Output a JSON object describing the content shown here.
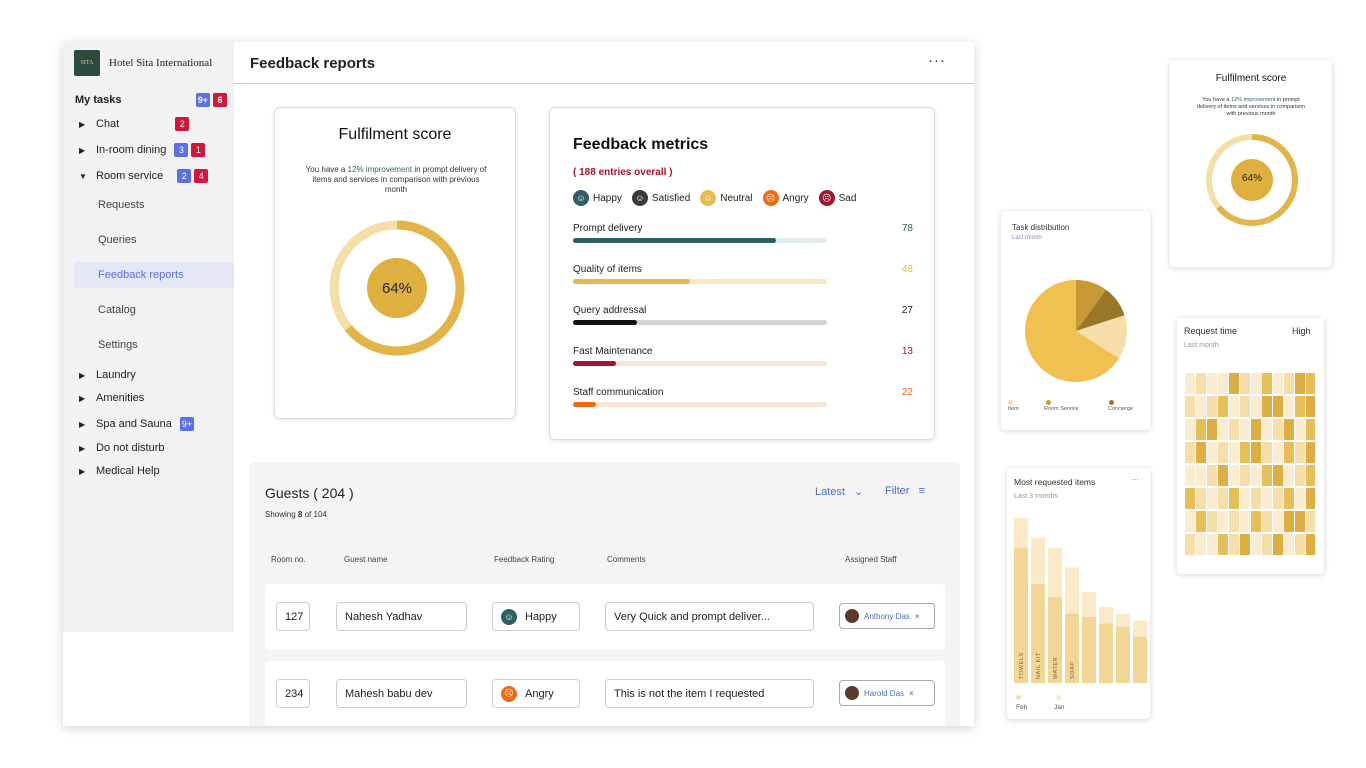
{
  "brand": {
    "name": "Hotel Sita International",
    "logo_text": "SITA"
  },
  "sidebar": {
    "heading": "My tasks",
    "heading_badges": [
      "9+",
      "6"
    ],
    "items": [
      {
        "label": "Chat",
        "badges": [
          "2"
        ]
      },
      {
        "label": "In-room dining",
        "badges": [
          "3",
          "1"
        ]
      },
      {
        "label": "Room service",
        "badges": [
          "2",
          "4"
        ]
      },
      {
        "label": "Laundry"
      },
      {
        "label": "Amenities"
      },
      {
        "label": "Spa and Sauna",
        "badges": [
          "9+"
        ]
      },
      {
        "label": "Do not disturb"
      },
      {
        "label": "Medical Help"
      }
    ],
    "subitems": [
      "Requests",
      "Queries",
      "Feedback reports",
      "Catalog",
      "Settings"
    ]
  },
  "header": {
    "title": "Feedback reports",
    "more": "···"
  },
  "fulfilment": {
    "title": "Fulfilment score",
    "desc_pre": "You have a ",
    "desc_hl": "12% improvement",
    "desc_post": " in prompt delivery of items and services in comparison with previous month",
    "score": "64%",
    "score_value": 0.64
  },
  "metrics": {
    "title": "Feedback metrics",
    "entries": "( 188  entries overall )",
    "legend": [
      {
        "label": "Happy",
        "color": "#2f5f63"
      },
      {
        "label": "Satisfied",
        "color": "#3a3a3a"
      },
      {
        "label": "Neutral",
        "color": "#e7b94f"
      },
      {
        "label": "Angry",
        "color": "#ec6a12"
      },
      {
        "label": "Sad",
        "color": "#a0152f"
      }
    ],
    "rows": [
      {
        "label": "Prompt  delivery",
        "value": "78",
        "fraction": 0.8,
        "color": "#2f5f63",
        "track": "#e1eeef",
        "value_color": "#2f5f63"
      },
      {
        "label": "Quality of items",
        "value": "48",
        "fraction": 0.46,
        "color": "#e7b94f",
        "track": "#f8e6bf",
        "value_color": "#e7b94f"
      },
      {
        "label": "Query addressal",
        "value": "27",
        "fraction": 0.25,
        "color": "#111111",
        "track": "#d4d4d4",
        "value_color": "#222222"
      },
      {
        "label": "Fast Maintenance",
        "value": "13",
        "fraction": 0.17,
        "color": "#a0152f",
        "track": "#fde2d6",
        "value_color": "#a0152f"
      },
      {
        "label": "Staff communication",
        "value": "22",
        "fraction": 0.09,
        "color": "#ec6a12",
        "track": "#fde2d6",
        "value_color": "#ec6a12"
      }
    ]
  },
  "guests": {
    "title": "Guests ( 204 )",
    "showing_pre": "Showing ",
    "showing_bold": "8",
    "showing_post": " of 104",
    "sort_label": "Latest",
    "filter_label": "Filter",
    "columns": [
      "Room no.",
      "Guest name",
      "Feedback Rating",
      "Comments",
      "Assigned Staff"
    ],
    "rows": [
      {
        "room": "127",
        "name": "Nahesh Yadhav",
        "rating": "Happy",
        "rating_color": "#2f5f63",
        "comment": "Very Quick and prompt deliver...",
        "staff": "Anthony Das"
      },
      {
        "room": "234",
        "name": "Mahesh babu dev",
        "rating": "Angry",
        "rating_color": "#ec6a12",
        "comment": "This is not the item I requested",
        "staff": "Harold Das"
      }
    ]
  },
  "mini_fulfilment": {
    "title": "Fulfilment score",
    "desc_pre": "You have a ",
    "desc_hl": "12% improvement",
    "desc_post": " in prompt delivery of items and services in comparison with previous month",
    "score": "64%"
  },
  "task_distribution": {
    "title": "Task distribution",
    "subtitle": "Last month",
    "chart_data": {
      "type": "pie",
      "series": [
        {
          "name": "Item",
          "value": 0.66,
          "color": "#f0c050"
        },
        {
          "name": "Room Service",
          "value": 0.14,
          "color": "#f5deaa"
        },
        {
          "name": "Concierge",
          "value": 0.1,
          "color": "#9a7628"
        },
        {
          "name": "",
          "value": 0.1,
          "color": "#c89a35"
        }
      ]
    },
    "legend": [
      "Item",
      "Room Service",
      "Concierge"
    ]
  },
  "request_time": {
    "title": "Request time",
    "level": "High",
    "subtitle": "Last month"
  },
  "most_requested": {
    "title": "Most requested items",
    "subtitle": "Last 3 months",
    "more": "···",
    "chart_data": {
      "type": "bar",
      "categories": [
        "TOWELS",
        "NAIL KIT",
        "WATER",
        "SOAP",
        "",
        "",
        "",
        ""
      ],
      "series": [
        {
          "name": "Feb",
          "values": [
            0.82,
            0.6,
            0.52,
            0.42,
            0.4,
            0.36,
            0.34,
            0.28
          ]
        },
        {
          "name": "Jan",
          "values": [
            1.0,
            0.88,
            0.82,
            0.7,
            0.55,
            0.46,
            0.42,
            0.38
          ]
        }
      ]
    },
    "legend": [
      "Feb",
      "Jan"
    ]
  }
}
